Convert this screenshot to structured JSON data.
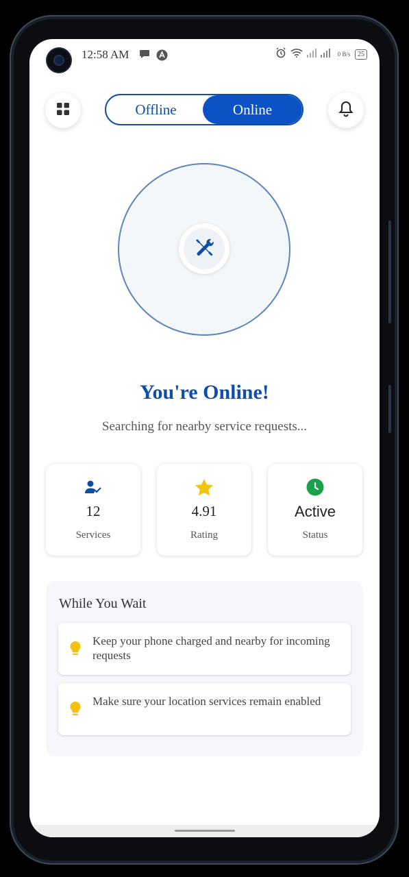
{
  "status_bar": {
    "time": "12:58 AM",
    "icons": [
      "chat-bubble-icon",
      "app-badge-icon",
      "alarm-icon",
      "wifi-icon",
      "signal-icon"
    ],
    "data_speed": "0 B/s",
    "battery": "25"
  },
  "header": {
    "menu_icon": "grid-icon",
    "toggle": {
      "offline_label": "Offline",
      "online_label": "Online",
      "selected": "Online"
    },
    "notifications_icon": "bell-icon"
  },
  "radar": {
    "center_icon": "tools-icon"
  },
  "main": {
    "title": "You're Online!",
    "subtitle": "Searching for nearby service requests..."
  },
  "stats": [
    {
      "icon": "user-check-icon",
      "value": "12",
      "label": "Services"
    },
    {
      "icon": "star-icon",
      "value": "4.91",
      "label": "Rating"
    },
    {
      "icon": "clock-icon",
      "value": "Active",
      "label": "Status"
    }
  ],
  "tips": {
    "title": "While You Wait",
    "items": [
      {
        "icon": "lightbulb-icon",
        "text": "Keep your phone charged and nearby for incoming requests"
      },
      {
        "icon": "lightbulb-icon",
        "text": "Make sure your location services remain enabled"
      }
    ]
  },
  "colors": {
    "primary": "#0d52c4",
    "accent_star": "#f4c20d",
    "status_green": "#18a24a",
    "bulb_yellow": "#f4c20d"
  }
}
